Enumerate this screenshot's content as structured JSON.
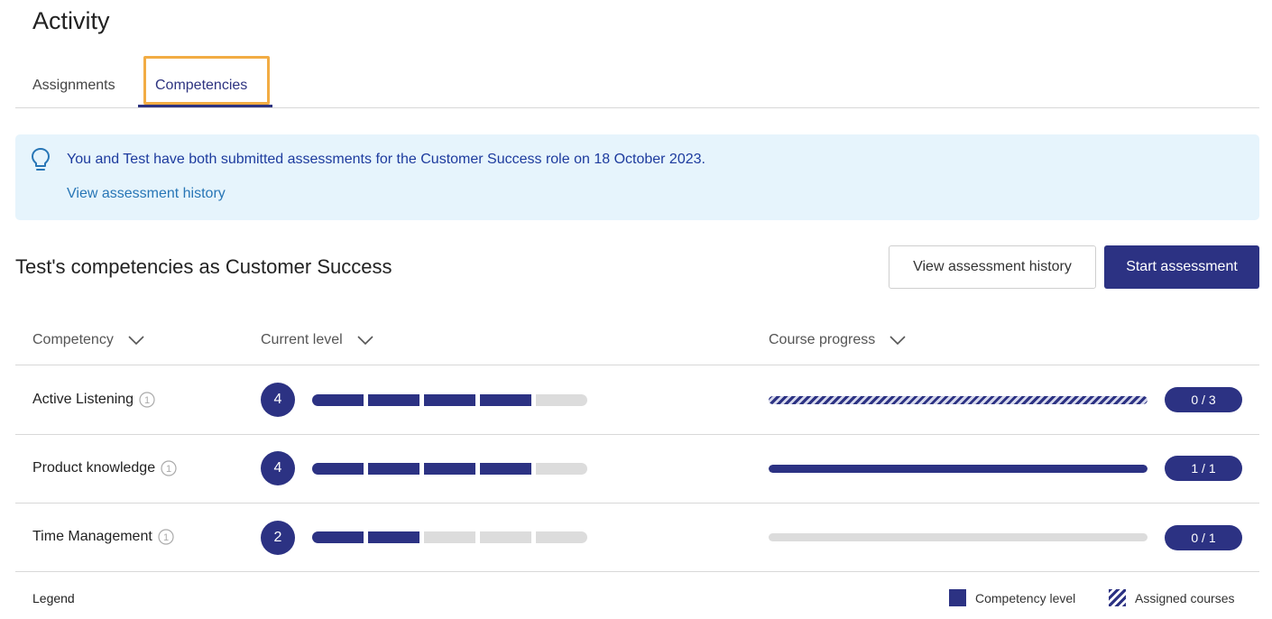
{
  "page": {
    "title": "Activity"
  },
  "tabs": [
    {
      "label": "Assignments",
      "active": false
    },
    {
      "label": "Competencies",
      "active": true
    }
  ],
  "banner": {
    "icon": "lightbulb-icon",
    "text": "You and Test have both submitted assessments for the Customer Success role on 18 October 2023.",
    "link": "View assessment history"
  },
  "section": {
    "title": "Test's competencies as Customer Success",
    "history_button": "View assessment history",
    "start_button": "Start assessment"
  },
  "table": {
    "columns": [
      "Competency",
      "Current level",
      "Course progress"
    ],
    "rows": [
      {
        "name": "Active Listening",
        "level": "4",
        "level_value": 4,
        "max_level": 5,
        "progress_label": "0 / 3",
        "completed": 0,
        "total": 3,
        "progress_style": "assigned"
      },
      {
        "name": "Product knowledge",
        "level": "4",
        "level_value": 4,
        "max_level": 5,
        "progress_label": "1 / 1",
        "completed": 1,
        "total": 1,
        "progress_style": "completed"
      },
      {
        "name": "Time Management",
        "level": "2",
        "level_value": 2,
        "max_level": 5,
        "progress_label": "0 / 1",
        "completed": 0,
        "total": 1,
        "progress_style": "none"
      }
    ]
  },
  "legend": {
    "label": "Legend",
    "items": [
      {
        "label": "Competency level",
        "icon": "solid-swatch"
      },
      {
        "label": "Assigned courses",
        "icon": "striped-swatch"
      }
    ]
  },
  "colors": {
    "accent": "#2c3283",
    "highlight": "#f2ac44",
    "banner_bg": "#e6f4fc",
    "link": "#2876b6"
  }
}
